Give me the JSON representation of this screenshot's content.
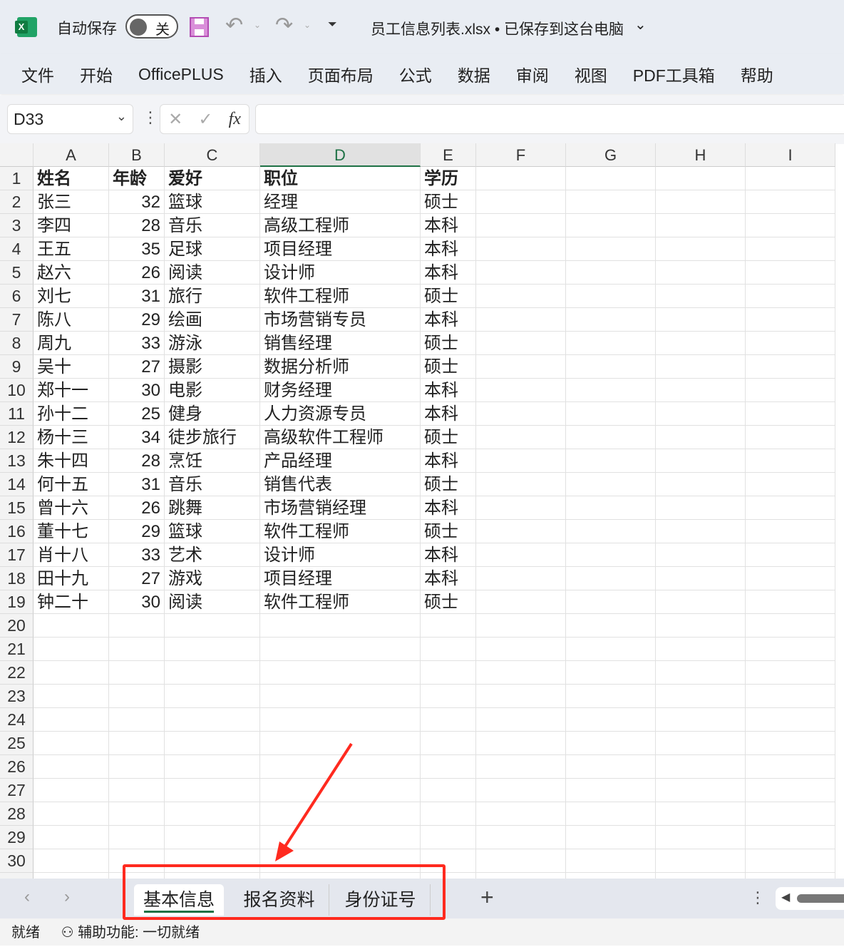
{
  "titlebar": {
    "autosave_label": "自动保存",
    "autosave_state": "关",
    "document_title": "员工信息列表.xlsx • 已保存到这台电脑"
  },
  "menu": [
    "文件",
    "开始",
    "OfficePLUS",
    "插入",
    "页面布局",
    "公式",
    "数据",
    "审阅",
    "视图",
    "PDF工具箱",
    "帮助"
  ],
  "formula_bar": {
    "name_box": "D33",
    "formula": ""
  },
  "columns": [
    "A",
    "B",
    "C",
    "D",
    "E",
    "F",
    "G",
    "H",
    "I"
  ],
  "selected_column": "D",
  "header_row": [
    "姓名",
    "年龄",
    "爱好",
    "职位",
    "学历"
  ],
  "rows": [
    [
      "张三",
      32,
      "篮球",
      "经理",
      "硕士"
    ],
    [
      "李四",
      28,
      "音乐",
      "高级工程师",
      "本科"
    ],
    [
      "王五",
      35,
      "足球",
      "项目经理",
      "本科"
    ],
    [
      "赵六",
      26,
      "阅读",
      "设计师",
      "本科"
    ],
    [
      "刘七",
      31,
      "旅行",
      "软件工程师",
      "硕士"
    ],
    [
      "陈八",
      29,
      "绘画",
      "市场营销专员",
      "本科"
    ],
    [
      "周九",
      33,
      "游泳",
      "销售经理",
      "硕士"
    ],
    [
      "吴十",
      27,
      "摄影",
      "数据分析师",
      "硕士"
    ],
    [
      "郑十一",
      30,
      "电影",
      "财务经理",
      "本科"
    ],
    [
      "孙十二",
      25,
      "健身",
      "人力资源专员",
      "本科"
    ],
    [
      "杨十三",
      34,
      "徒步旅行",
      "高级软件工程师",
      "硕士"
    ],
    [
      "朱十四",
      28,
      "烹饪",
      "产品经理",
      "本科"
    ],
    [
      "何十五",
      31,
      "音乐",
      "销售代表",
      "硕士"
    ],
    [
      "曾十六",
      26,
      "跳舞",
      "市场营销经理",
      "本科"
    ],
    [
      "董十七",
      29,
      "篮球",
      "软件工程师",
      "硕士"
    ],
    [
      "肖十八",
      33,
      "艺术",
      "设计师",
      "本科"
    ],
    [
      "田十九",
      27,
      "游戏",
      "项目经理",
      "本科"
    ],
    [
      "钟二十",
      30,
      "阅读",
      "软件工程师",
      "硕士"
    ]
  ],
  "visible_row_count": 30,
  "sheets": [
    "基本信息",
    "报名资料",
    "身份证号"
  ],
  "active_sheet": "基本信息",
  "status": {
    "ready": "就绪",
    "accessibility": "辅助功能: 一切就绪"
  },
  "colors": {
    "accent": "#1e7145",
    "annotation": "#ff2a1f",
    "save_icon": "#b34db3"
  }
}
